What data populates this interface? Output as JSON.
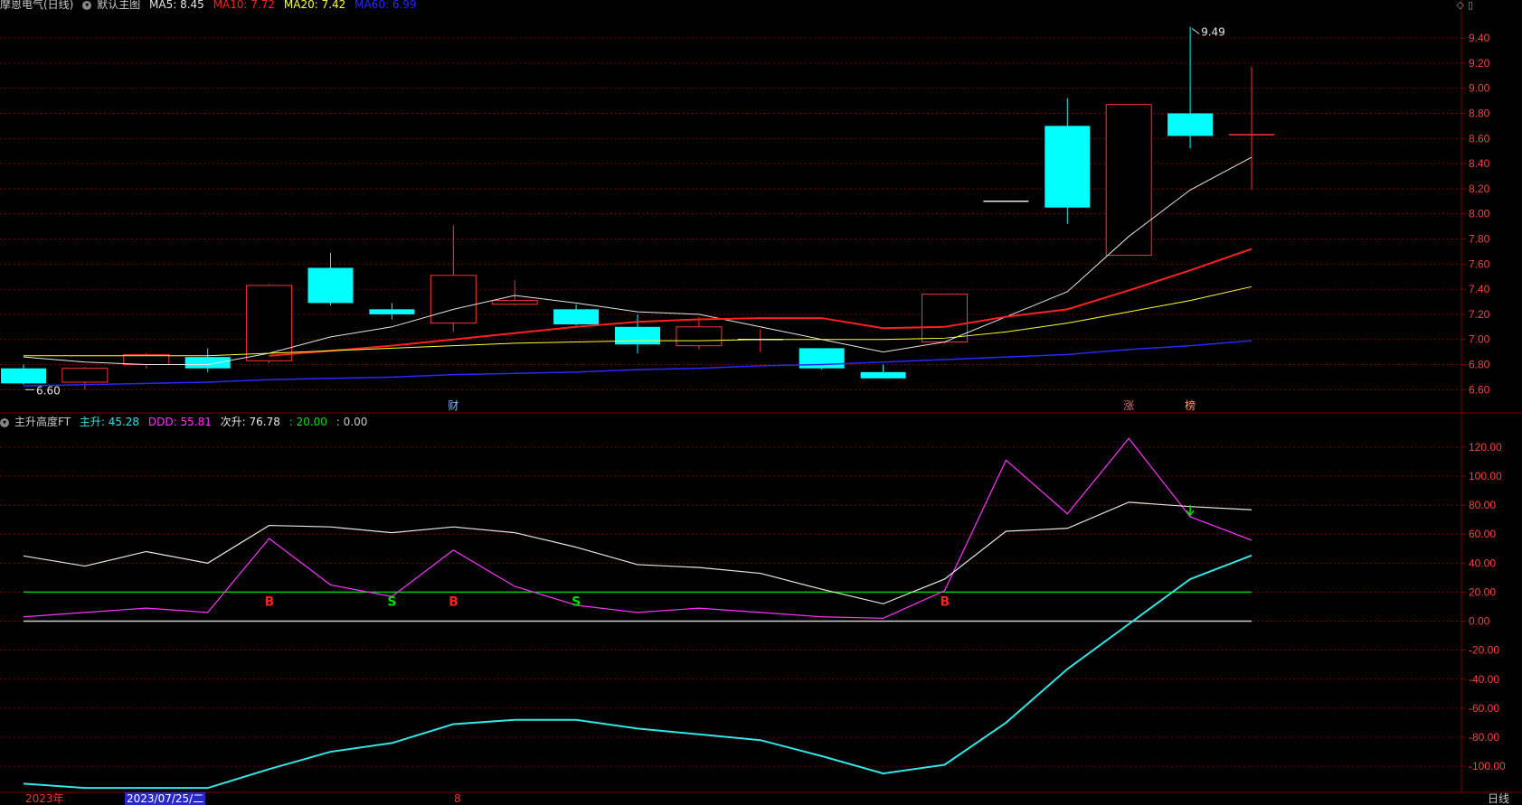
{
  "header": {
    "stock": "摩恩电气(日线)",
    "main_chart_label": "默认主图",
    "ma5": "MA5: 8.45",
    "ma10": "MA10: 7.72",
    "ma20": "MA20: 7.42",
    "ma60": "MA60: 6.99"
  },
  "indicator_header": {
    "name": "主升高度FT",
    "zhusheng": "主升: 45.28",
    "ddd": "DDD: 55.81",
    "cisheng": "次升: 76.78",
    "line20": ": 20.00",
    "line0": ": 0.00"
  },
  "date_bar": {
    "year": "2023年",
    "cursor_date": "2023/07/25/二",
    "month": "8",
    "period": "日线"
  },
  "colors": {
    "up": "#ff3232",
    "down": "#00ffff",
    "ma5": "#e6e6e6",
    "ma10": "#ff2020",
    "ma20": "#ffff33",
    "ma60": "#2828ff",
    "ddd": "#ff33ff",
    "zhusheng": "#33e6e6",
    "cisheng": "#e6e6e6",
    "grid": "#7a0000",
    "axis_text": "#ff4040"
  },
  "chart_data": [
    {
      "type": "candlestick",
      "y_axis_ticks": [
        "6.60",
        "6.80",
        "7.00",
        "7.20",
        "7.40",
        "7.60",
        "7.80",
        "8.00",
        "8.20",
        "8.40",
        "8.60",
        "8.80",
        "9.00",
        "9.20",
        "9.40"
      ],
      "ylim": [
        6.48,
        9.58
      ],
      "annotations": {
        "low": "6.60",
        "high": "9.49"
      },
      "event_markers": [
        {
          "index": 7,
          "label": "财",
          "color": "#8ab4ff"
        },
        {
          "index": 18,
          "label": "涨",
          "color": "#ff6060"
        },
        {
          "index": 19,
          "label": "榜",
          "color": "#ff9966"
        }
      ],
      "candles": [
        {
          "o": 6.77,
          "h": 6.8,
          "l": 6.64,
          "c": 6.65
        },
        {
          "o": 6.66,
          "h": 6.78,
          "l": 6.6,
          "c": 6.77
        },
        {
          "o": 6.8,
          "h": 6.89,
          "l": 6.77,
          "c": 6.88
        },
        {
          "o": 6.86,
          "h": 6.93,
          "l": 6.74,
          "c": 6.77
        },
        {
          "o": 6.83,
          "h": 7.44,
          "l": 6.81,
          "c": 7.43
        },
        {
          "o": 7.57,
          "h": 7.69,
          "l": 7.27,
          "c": 7.29
        },
        {
          "o": 7.24,
          "h": 7.29,
          "l": 7.16,
          "c": 7.2
        },
        {
          "o": 7.13,
          "h": 7.91,
          "l": 7.06,
          "c": 7.51
        },
        {
          "o": 7.28,
          "h": 7.47,
          "l": 7.27,
          "c": 7.31
        },
        {
          "o": 7.24,
          "h": 7.28,
          "l": 7.11,
          "c": 7.12
        },
        {
          "o": 7.1,
          "h": 7.2,
          "l": 6.89,
          "c": 6.96
        },
        {
          "o": 6.95,
          "h": 7.18,
          "l": 6.92,
          "c": 7.1
        },
        {
          "o": 7.0,
          "h": 7.08,
          "l": 6.9,
          "c": 7.0
        },
        {
          "o": 6.93,
          "h": 6.93,
          "l": 6.76,
          "c": 6.77
        },
        {
          "o": 6.74,
          "h": 6.8,
          "l": 6.69,
          "c": 6.69
        },
        {
          "o": 6.98,
          "h": 7.36,
          "l": 6.97,
          "c": 7.36
        },
        {
          "o": 8.1,
          "h": 8.1,
          "l": 8.1,
          "c": 8.1
        },
        {
          "o": 8.7,
          "h": 8.92,
          "l": 7.92,
          "c": 8.05
        },
        {
          "o": 7.67,
          "h": 8.87,
          "l": 7.67,
          "c": 8.87
        },
        {
          "o": 8.8,
          "h": 9.49,
          "l": 8.52,
          "c": 8.62
        },
        {
          "o": 8.63,
          "h": 9.17,
          "l": 8.19,
          "c": 8.63
        }
      ],
      "series": [
        {
          "name": "MA5",
          "values": [
            6.86,
            6.82,
            6.8,
            6.8,
            6.89,
            7.02,
            7.1,
            7.24,
            7.35,
            7.29,
            7.22,
            7.2,
            7.1,
            7.0,
            6.9,
            6.98,
            7.18,
            7.38,
            7.82,
            8.19,
            8.45
          ]
        },
        {
          "name": "MA10",
          "values": [
            null,
            null,
            null,
            null,
            6.87,
            6.91,
            6.95,
            7.0,
            7.05,
            7.1,
            7.14,
            7.16,
            7.17,
            7.17,
            7.09,
            7.1,
            7.18,
            7.24,
            7.39,
            7.55,
            7.72
          ]
        },
        {
          "name": "MA20",
          "values": [
            6.87,
            6.87,
            6.87,
            6.87,
            6.89,
            6.91,
            6.93,
            6.95,
            6.97,
            6.98,
            6.99,
            6.99,
            7.0,
            7.0,
            7.0,
            7.01,
            7.06,
            7.13,
            7.22,
            7.31,
            7.42
          ]
        },
        {
          "name": "MA60",
          "values": [
            6.63,
            6.64,
            6.65,
            6.66,
            6.68,
            6.69,
            6.7,
            6.72,
            6.73,
            6.74,
            6.76,
            6.77,
            6.79,
            6.8,
            6.82,
            6.84,
            6.86,
            6.88,
            6.92,
            6.95,
            6.99
          ]
        }
      ]
    },
    {
      "type": "line",
      "y_axis_ticks": [
        "120.00",
        "100.00",
        "80.00",
        "60.00",
        "40.00",
        "20.00",
        "0.00",
        "-20.00",
        "-40.00",
        "-60.00",
        "-80.00",
        "-100.00"
      ],
      "ylim": [
        -118,
        133
      ],
      "reference_lines": [
        20,
        0
      ],
      "series": [
        {
          "name": "DDD",
          "values": [
            3,
            6,
            9,
            6,
            57,
            25,
            17,
            49,
            24,
            11,
            6,
            9,
            6,
            3,
            2,
            21,
            111,
            74,
            126,
            72,
            55.81
          ]
        },
        {
          "name": "主升",
          "values": [
            -112,
            -115,
            -115,
            -115,
            -102,
            -90,
            -84,
            -71,
            -68,
            -68,
            -74,
            -78,
            -82,
            -93,
            -105,
            -99,
            -70,
            -33,
            -2,
            29,
            45.28
          ]
        },
        {
          "name": "次升",
          "values": [
            45,
            38,
            48,
            40,
            66,
            65,
            61,
            65,
            61,
            51,
            39,
            37,
            33,
            22,
            12,
            29,
            62,
            64,
            82,
            79,
            76.78
          ]
        }
      ],
      "signals": [
        {
          "index": 4,
          "label": "B",
          "color": "#ff2020"
        },
        {
          "index": 6,
          "label": "S",
          "color": "#00e000"
        },
        {
          "index": 7,
          "label": "B",
          "color": "#ff2020"
        },
        {
          "index": 9,
          "label": "S",
          "color": "#00e000"
        },
        {
          "index": 15,
          "label": "B",
          "color": "#ff2020"
        }
      ]
    }
  ]
}
